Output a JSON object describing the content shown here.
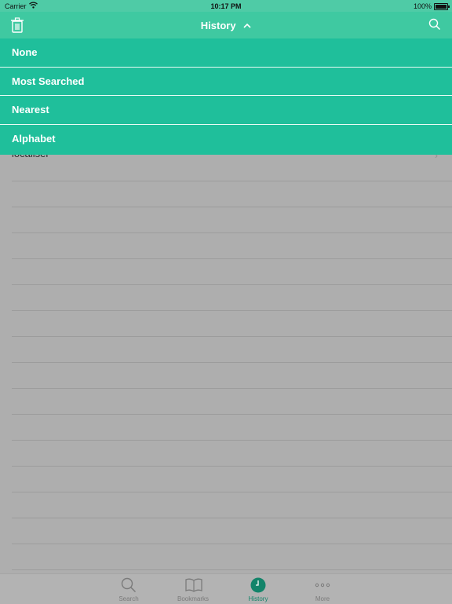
{
  "status_bar": {
    "carrier": "Carrier",
    "time": "10:17 PM",
    "battery": "100%"
  },
  "nav": {
    "title": "History",
    "chevron": "^",
    "left_icon": "trash-icon",
    "right_icon": "search-icon"
  },
  "sort_menu": {
    "items": [
      {
        "label": "None"
      },
      {
        "label": "Most Searched"
      },
      {
        "label": "Nearest"
      },
      {
        "label": "Alphabet"
      }
    ]
  },
  "history_list": {
    "partially_visible_entry": "localiser"
  },
  "tab_bar": {
    "tabs": [
      {
        "label": "Search",
        "icon": "search-icon",
        "active": false
      },
      {
        "label": "Bookmarks",
        "icon": "book-icon",
        "active": false
      },
      {
        "label": "History",
        "icon": "clock-icon",
        "active": true
      },
      {
        "label": "More",
        "icon": "more-dots-icon",
        "active": false
      }
    ]
  },
  "colors": {
    "nav": "#3fc9a1",
    "menu": "#1fbf9b",
    "accent": "#13846a",
    "dimmed_background": "#aeaeae"
  }
}
